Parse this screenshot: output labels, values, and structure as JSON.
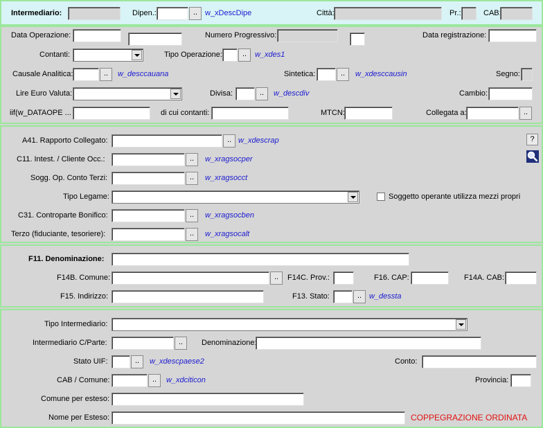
{
  "header": {
    "intermediario": "Intermediario:",
    "dipen": "Dipen.:",
    "dipen_desc": "w_xDescDipe",
    "citta": "Città:",
    "pr": "Pr.:",
    "cab": "CAB:"
  },
  "operazione": {
    "data_operazione": "Data Operazione:",
    "numero_progressivo": "Numero Progressivo:",
    "data_registrazione": "Data registrazione:",
    "contanti": "Contanti:",
    "tipo_operazione": "Tipo Operazione:",
    "tipo_operazione_desc": "w_xdes1",
    "causale_analitica": "Causale Analitica:",
    "causale_analitica_desc": "w_desccauana",
    "sintetica": "Sintetica:",
    "sintetica_desc": "w_xdesccausin",
    "segno": "Segno:",
    "lire_euro_valuta": "Lire Euro Valuta:",
    "divisa": "Divisa:",
    "divisa_desc": "w_descdiv",
    "cambio": "Cambio:",
    "iif": "iif(w_DATAOPE ...",
    "di_cui_contanti": "di cui contanti:",
    "mtcn": "MTCN:",
    "collegata_a": "Collegata a:"
  },
  "soggetti": {
    "a41": "A41. Rapporto Collegato:",
    "a41_desc": "w_xdescrap",
    "c11": "C11. Intest. / Cliente Occ.:",
    "c11_desc": "w_xragsocper",
    "sogg_op": "Sogg. Op. Conto Terzi:",
    "sogg_op_desc": "w_xragsocct",
    "tipo_legame": "Tipo Legame:",
    "soggetto_operante": "Soggetto operante utilizza mezzi propri",
    "c31": "C31. Controparte Bonifico:",
    "c31_desc": "w_xragsocben",
    "terzo": "Terzo (fiduciante, tesoriere):",
    "terzo_desc": "w_xragsocalt",
    "help": "?"
  },
  "beneficiario": {
    "f11": "F11. Denominazione:",
    "f14b": "F14B. Comune:",
    "f14c": "F14C. Prov.:",
    "f16": "F16. CAP:",
    "f14a": "F14A. CAB:",
    "f15": "F15. Indirizzo:",
    "f13": "F13. Stato:",
    "f13_desc": "w_dessta"
  },
  "intermediario_cp": {
    "tipo_intermediario": "Tipo Intermediario:",
    "intermediario_cparte": "Intermediario C/Parte:",
    "denominazione": "Denominazione:",
    "stato_uif": "Stato UIF:",
    "stato_uif_desc": "w_xdescpaese2",
    "conto": "Conto:",
    "cab_comune": "CAB / Comune:",
    "cab_comune_desc": "w_xdciticon",
    "provincia": "Provincia:",
    "comune_esteso": "Comune per esteso:",
    "nome_esteso": "Nome per Esteso:",
    "red_text": "COPPEGRAZIONE ORDINATA"
  },
  "ellipsis": ".."
}
